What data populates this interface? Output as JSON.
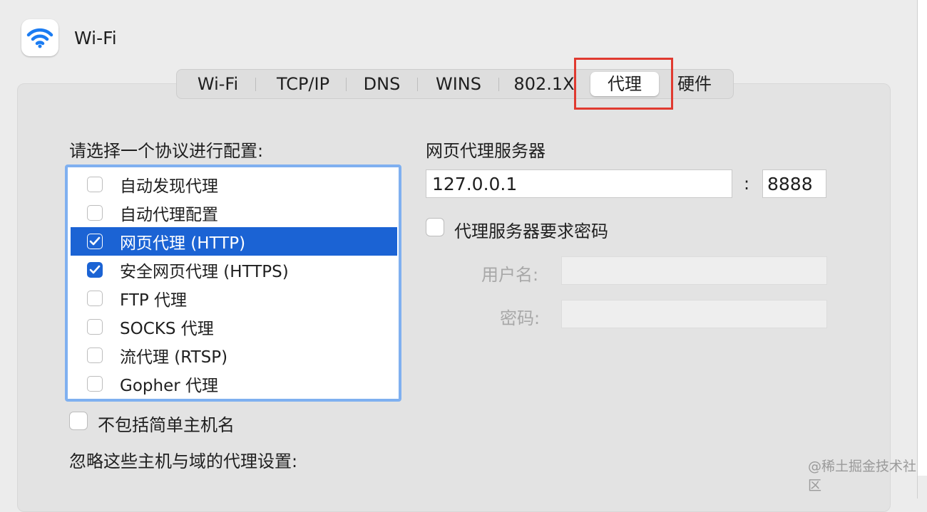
{
  "header": {
    "title": "Wi-Fi",
    "icon": "wifi-icon"
  },
  "tabs": [
    {
      "label": "Wi-Fi",
      "active": false
    },
    {
      "label": "TCP/IP",
      "active": false
    },
    {
      "label": "DNS",
      "active": false
    },
    {
      "label": "WINS",
      "active": false
    },
    {
      "label": "802.1X",
      "active": false
    },
    {
      "label": "代理",
      "active": true
    },
    {
      "label": "硬件",
      "active": false
    }
  ],
  "protocol_section": {
    "label": "请选择一个协议进行配置:",
    "items": [
      {
        "label": "自动发现代理",
        "checked": false,
        "selected": false
      },
      {
        "label": "自动代理配置",
        "checked": false,
        "selected": false
      },
      {
        "label": "网页代理 (HTTP)",
        "checked": true,
        "selected": true
      },
      {
        "label": "安全网页代理 (HTTPS)",
        "checked": true,
        "selected": false
      },
      {
        "label": "FTP 代理",
        "checked": false,
        "selected": false
      },
      {
        "label": "SOCKS 代理",
        "checked": false,
        "selected": false
      },
      {
        "label": "流代理 (RTSP)",
        "checked": false,
        "selected": false
      },
      {
        "label": "Gopher 代理",
        "checked": false,
        "selected": false
      }
    ]
  },
  "exclude_simple": {
    "label": "不包括简单主机名",
    "checked": false
  },
  "bypass": {
    "label": "忽略这些主机与域的代理设置:"
  },
  "proxy_server": {
    "label": "网页代理服务器",
    "host": "127.0.0.1",
    "colon": ":",
    "port": "8888",
    "require_password": {
      "label": "代理服务器要求密码",
      "checked": false
    },
    "username": {
      "label": "用户名:",
      "value": ""
    },
    "password": {
      "label": "密码:",
      "value": ""
    }
  },
  "watermark": "@稀土掘金技术社区",
  "colors": {
    "accent": "#1b63d4",
    "highlight_box": "#e03a30",
    "focus_ring": "#7fb0f0"
  }
}
